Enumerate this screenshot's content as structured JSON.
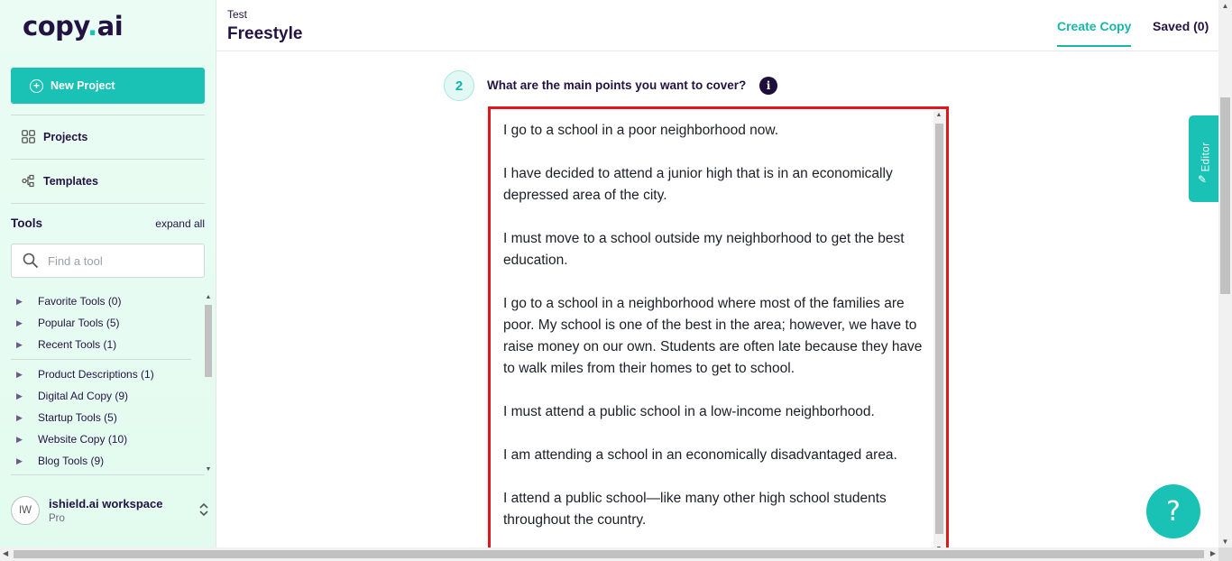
{
  "sidebar": {
    "logo_main": "copy",
    "logo_dot": ".",
    "logo_tail": "ai",
    "new_project": "New Project",
    "nav": {
      "projects": "Projects",
      "templates": "Templates"
    },
    "tools_title": "Tools",
    "expand_all": "expand all",
    "search_placeholder": "Find a tool",
    "tool_groups_top": [
      "Favorite Tools (0)",
      "Popular Tools (5)",
      "Recent Tools (1)"
    ],
    "tool_groups": [
      "Product Descriptions (1)",
      "Digital Ad Copy (9)",
      "Startup Tools (5)",
      "Website Copy (10)",
      "Blog Tools (9)"
    ],
    "workspace": {
      "initials": "IW",
      "name": "ishield.ai workspace",
      "plan": "Pro"
    }
  },
  "header": {
    "breadcrumb": "Test",
    "title": "Freestyle",
    "tabs": {
      "create": "Create Copy",
      "saved": "Saved (0)"
    }
  },
  "main": {
    "step_number": "2",
    "question": "What are the main points you want to cover?",
    "info_glyph": "i",
    "points_text": "I go to a school in a poor neighborhood now.\n\nI have decided to attend a junior high that is in an economically depressed area of the city.\n\nI must move to a school outside my neighborhood to get the best education.\n\nI go to a school in a neighborhood where most of the families are poor. My school is one of the best in the area; however, we have to raise money on our own. Students are often late because they have to walk miles from their homes to get to school.\n\nI must attend a public school in a low-income neighborhood.\n\nI am attending a school in an economically disadvantaged area.\n\nI attend a public school—like many other high school students throughout the country."
  },
  "editor_tab": "Editor",
  "help_glyph": "?",
  "colors": {
    "accent": "#19c2b4",
    "brand_dark": "#231343",
    "highlight_border": "#e0161b"
  },
  "icons": [
    "plus-circle-icon",
    "grid-icon",
    "templates-icon",
    "search-icon",
    "caret-right-icon",
    "chevron-updown-icon",
    "info-icon",
    "pencil-icon",
    "help-icon"
  ]
}
